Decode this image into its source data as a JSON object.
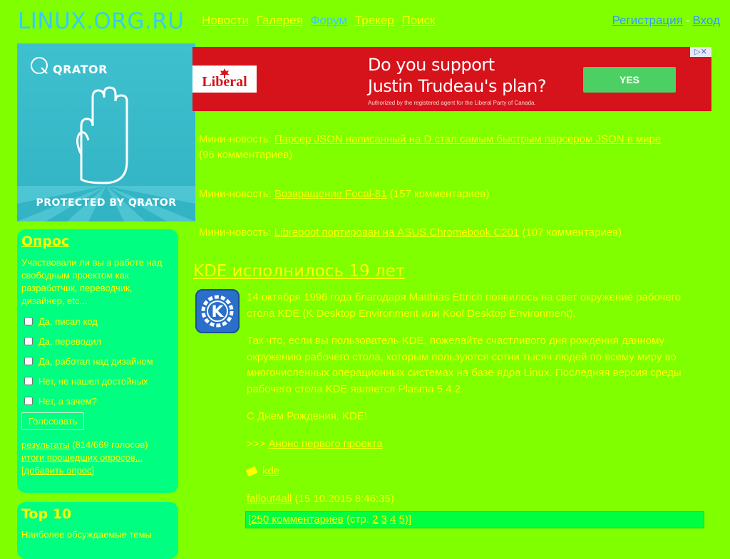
{
  "site": {
    "title": "LINUX.ORG.RU",
    "nav": [
      {
        "label": "Новости"
      },
      {
        "label": "Галерея"
      },
      {
        "label": "Форум"
      },
      {
        "label": "Трекер"
      },
      {
        "label": "Поиск"
      }
    ],
    "auth": {
      "register": "Регистрация",
      "separator": "-",
      "login": "Вход"
    }
  },
  "qrator": {
    "logo": "QRATOR",
    "protected": "PROTECTED BY QRATOR"
  },
  "ad": {
    "brand": "Liberal",
    "headline_line1": "Do you support",
    "headline_line2": "Justin Trudeau's plan?",
    "authorized": "Authorized by the registered agent for the Liberal Party of Canada.",
    "button": "YES",
    "adchoices": "▷✕"
  },
  "poll": {
    "title": "Опрос",
    "question": "Участвовали ли вы в работе над свободным проектом как разработчик, переводчик, дизайнер, etc...",
    "options": [
      "Да, писал код",
      "Да, переводил",
      "Да, работал над дизайном",
      "Нет, не нашел достойных",
      "Нет, а зачем?"
    ],
    "vote_button": "Голосовать",
    "results_link": "результаты",
    "results_count": "(814/669 голосов)",
    "past_link": "итоги прошедших опросов...",
    "add_link": "[добавить опрос]"
  },
  "top10": {
    "title": "Top 10",
    "subtitle": "Наиболее обсуждаемые темы"
  },
  "mini_news": [
    {
      "label": "Мини-новость:",
      "link": "Парсер JSON написанный на D стал самым быстрым парсером JSON в мире",
      "comments": "(96 комментариев)"
    },
    {
      "label": "Мини-новость:",
      "link": "Возвращение Focal-81",
      "comments": "(157 комментариев)"
    },
    {
      "label": "Мини-новость:",
      "link": "Libreboot портирован на ASUS Chromebook C201",
      "comments": "(107 комментариев)"
    }
  ],
  "article": {
    "title": "KDE исполнилось 19 лет",
    "p1": "14 октября 1996 года благодаря Matthias Ettrich появилось на свет окружение рабочего стола KDE (K Desktop Environment или Kool Desktop Environment).",
    "p2": "Так что, если вы пользователь KDE, пожелайте счастливого дня рождения данному окружению рабочего стола, которым пользуются сотни тысяч людей по всему миру во многочисленных операционных системах на базе ядра Linux. Последняя версия среды рабочего стола KDE является Plasma 5.4.2.",
    "p3": "С Днем Рождения, KDE!",
    "link_prefix": ">>>",
    "link": "Анонс первого проекта",
    "tag": "kde",
    "author": "fallout4all",
    "date": "(15.10.2015 8:46:35)",
    "comments_open": "[",
    "comments_link": "250 комментариев",
    "pages_prefix": "(стр.",
    "pages": [
      "2",
      "3",
      "4",
      "5"
    ],
    "pages_suffix": ")]"
  }
}
